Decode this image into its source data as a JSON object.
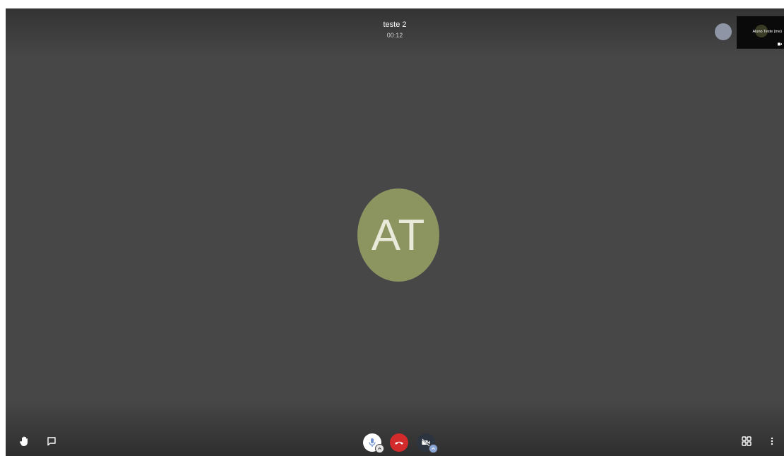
{
  "header": {
    "room_title": "teste 2",
    "timer": "00:12"
  },
  "main_participant": {
    "initials": "AT",
    "avatar_color": "#8c9460"
  },
  "filmstrip": {
    "local_name": "Aluno Teste (me)"
  },
  "toolbar": {
    "left": [
      "raise-hand-icon",
      "chat-icon"
    ],
    "center": [
      "microphone-icon",
      "hangup-icon",
      "camera-off-icon"
    ],
    "right": [
      "tile-view-icon",
      "more-options-icon"
    ],
    "hangup_color": "#d32b2b"
  }
}
